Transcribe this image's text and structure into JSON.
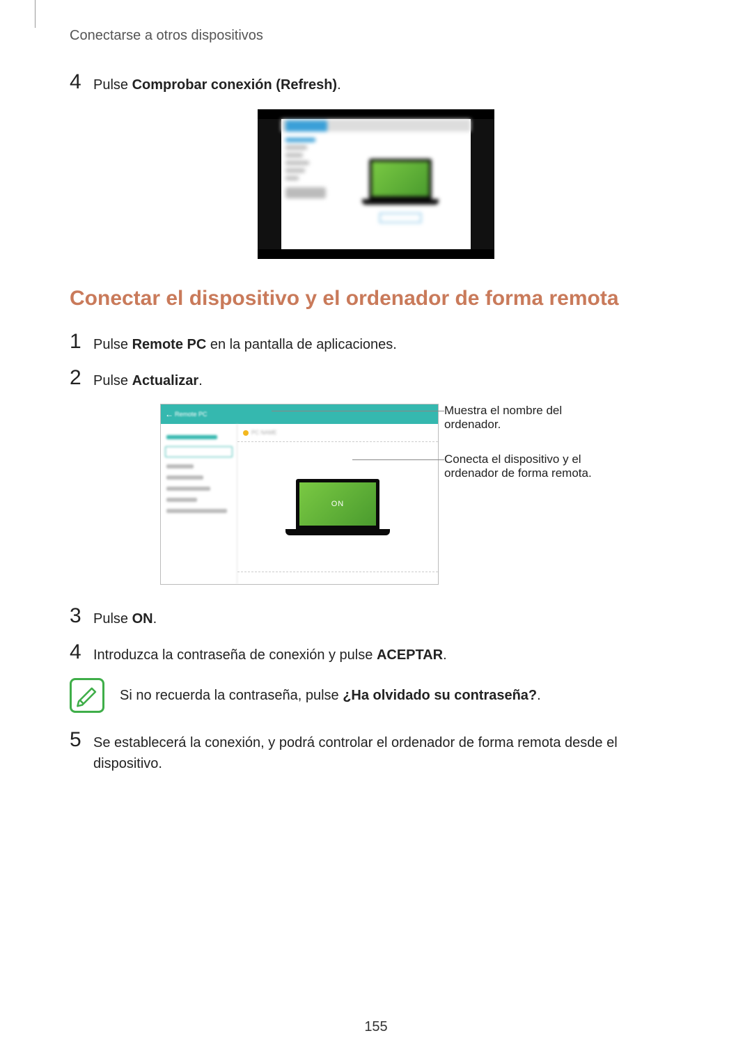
{
  "breadcrumb": "Conectarse a otros dispositivos",
  "step4a": {
    "num": "4",
    "prefix": "Pulse ",
    "bold": "Comprobar conexión (Refresh)",
    "suffix": "."
  },
  "section_heading": "Conectar el dispositivo y el ordenador de forma remota",
  "step1": {
    "num": "1",
    "prefix": "Pulse ",
    "bold": "Remote PC",
    "suffix": " en la pantalla de aplicaciones."
  },
  "step2": {
    "num": "2",
    "prefix": "Pulse ",
    "bold": "Actualizar",
    "suffix": "."
  },
  "fig2": {
    "on_label": "ON"
  },
  "callout1": "Muestra el nombre del ordenador.",
  "callout2": "Conecta el dispositivo y el ordenador de forma remota.",
  "step3": {
    "num": "3",
    "prefix": "Pulse ",
    "bold": "ON",
    "suffix": "."
  },
  "step4b": {
    "num": "4",
    "prefix": "Introduzca la contraseña de conexión y pulse ",
    "bold": "ACEPTAR",
    "suffix": "."
  },
  "note": {
    "prefix": "Si no recuerda la contraseña, pulse ",
    "bold": "¿Ha olvidado su contraseña?",
    "suffix": "."
  },
  "step5": {
    "num": "5",
    "text": "Se establecerá la conexión, y podrá controlar el ordenador de forma remota desde el dispositivo."
  },
  "page_number": "155"
}
